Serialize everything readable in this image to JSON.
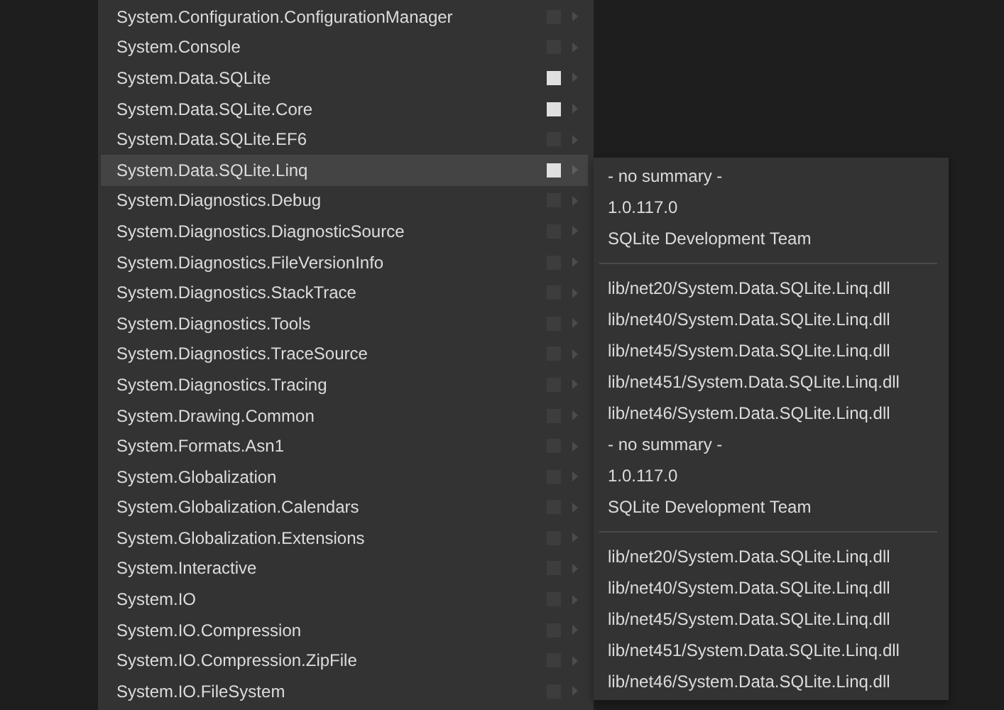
{
  "menu": {
    "items": [
      {
        "label": "System.Configuration.ConfigurationManager",
        "checked": false,
        "selected": false
      },
      {
        "label": "System.Console",
        "checked": false,
        "selected": false
      },
      {
        "label": "System.Data.SQLite",
        "checked": true,
        "selected": false
      },
      {
        "label": "System.Data.SQLite.Core",
        "checked": true,
        "selected": false
      },
      {
        "label": "System.Data.SQLite.EF6",
        "checked": false,
        "selected": false
      },
      {
        "label": "System.Data.SQLite.Linq",
        "checked": true,
        "selected": true
      },
      {
        "label": "System.Diagnostics.Debug",
        "checked": false,
        "selected": false
      },
      {
        "label": "System.Diagnostics.DiagnosticSource",
        "checked": false,
        "selected": false
      },
      {
        "label": "System.Diagnostics.FileVersionInfo",
        "checked": false,
        "selected": false
      },
      {
        "label": "System.Diagnostics.StackTrace",
        "checked": false,
        "selected": false
      },
      {
        "label": "System.Diagnostics.Tools",
        "checked": false,
        "selected": false
      },
      {
        "label": "System.Diagnostics.TraceSource",
        "checked": false,
        "selected": false
      },
      {
        "label": "System.Diagnostics.Tracing",
        "checked": false,
        "selected": false
      },
      {
        "label": "System.Drawing.Common",
        "checked": false,
        "selected": false
      },
      {
        "label": "System.Formats.Asn1",
        "checked": false,
        "selected": false
      },
      {
        "label": "System.Globalization",
        "checked": false,
        "selected": false
      },
      {
        "label": "System.Globalization.Calendars",
        "checked": false,
        "selected": false
      },
      {
        "label": "System.Globalization.Extensions",
        "checked": false,
        "selected": false
      },
      {
        "label": "System.Interactive",
        "checked": false,
        "selected": false
      },
      {
        "label": "System.IO",
        "checked": false,
        "selected": false
      },
      {
        "label": "System.IO.Compression",
        "checked": false,
        "selected": false
      },
      {
        "label": "System.IO.Compression.ZipFile",
        "checked": false,
        "selected": false
      },
      {
        "label": "System.IO.FileSystem",
        "checked": false,
        "selected": false
      }
    ]
  },
  "submenu": {
    "items": [
      {
        "kind": "text",
        "label": "- no summary -"
      },
      {
        "kind": "text",
        "label": "1.0.117.0"
      },
      {
        "kind": "text",
        "label": "SQLite Development Team"
      },
      {
        "kind": "separator"
      },
      {
        "kind": "text",
        "label": "lib/net20/System.Data.SQLite.Linq.dll"
      },
      {
        "kind": "text",
        "label": "lib/net40/System.Data.SQLite.Linq.dll"
      },
      {
        "kind": "text",
        "label": "lib/net45/System.Data.SQLite.Linq.dll"
      },
      {
        "kind": "text",
        "label": "lib/net451/System.Data.SQLite.Linq.dll"
      },
      {
        "kind": "text",
        "label": "lib/net46/System.Data.SQLite.Linq.dll"
      },
      {
        "kind": "text",
        "label": "- no summary -"
      },
      {
        "kind": "text",
        "label": "1.0.117.0"
      },
      {
        "kind": "text",
        "label": "SQLite Development Team"
      },
      {
        "kind": "separator"
      },
      {
        "kind": "text",
        "label": "lib/net20/System.Data.SQLite.Linq.dll"
      },
      {
        "kind": "text",
        "label": "lib/net40/System.Data.SQLite.Linq.dll"
      },
      {
        "kind": "text",
        "label": "lib/net45/System.Data.SQLite.Linq.dll"
      },
      {
        "kind": "text",
        "label": "lib/net451/System.Data.SQLite.Linq.dll"
      },
      {
        "kind": "text",
        "label": "lib/net46/System.Data.SQLite.Linq.dll"
      }
    ]
  }
}
